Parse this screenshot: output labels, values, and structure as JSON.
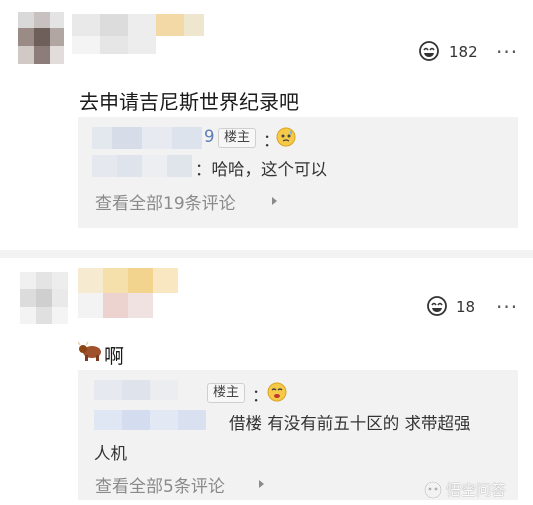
{
  "comment1": {
    "like_count": "182",
    "text": "去申请吉尼斯世界纪录吧",
    "reply": {
      "author_suffix": "9",
      "badge": "楼主",
      "colon": "：",
      "text": "：哈哈，这个可以"
    },
    "view_all": "查看全部19条评论"
  },
  "comment2": {
    "like_count": "18",
    "text": "啊",
    "reply": {
      "badge": "楼主",
      "colon": "：",
      "text_line1": "借楼 有没有前五十区的 求带超强",
      "text_line2": "人机"
    },
    "view_all": "查看全部5条评论"
  },
  "more_label": "···",
  "watermark": "悟空问答",
  "colors": {
    "reply_background": "#f2f2f2",
    "muted_text": "#8a8a8a"
  },
  "icons": [
    "like-icon",
    "more-icon",
    "chevron-right-icon",
    "cow-emoji-icon",
    "sweat-emoji-icon",
    "drool-emoji-icon",
    "wukong-logo-icon"
  ]
}
